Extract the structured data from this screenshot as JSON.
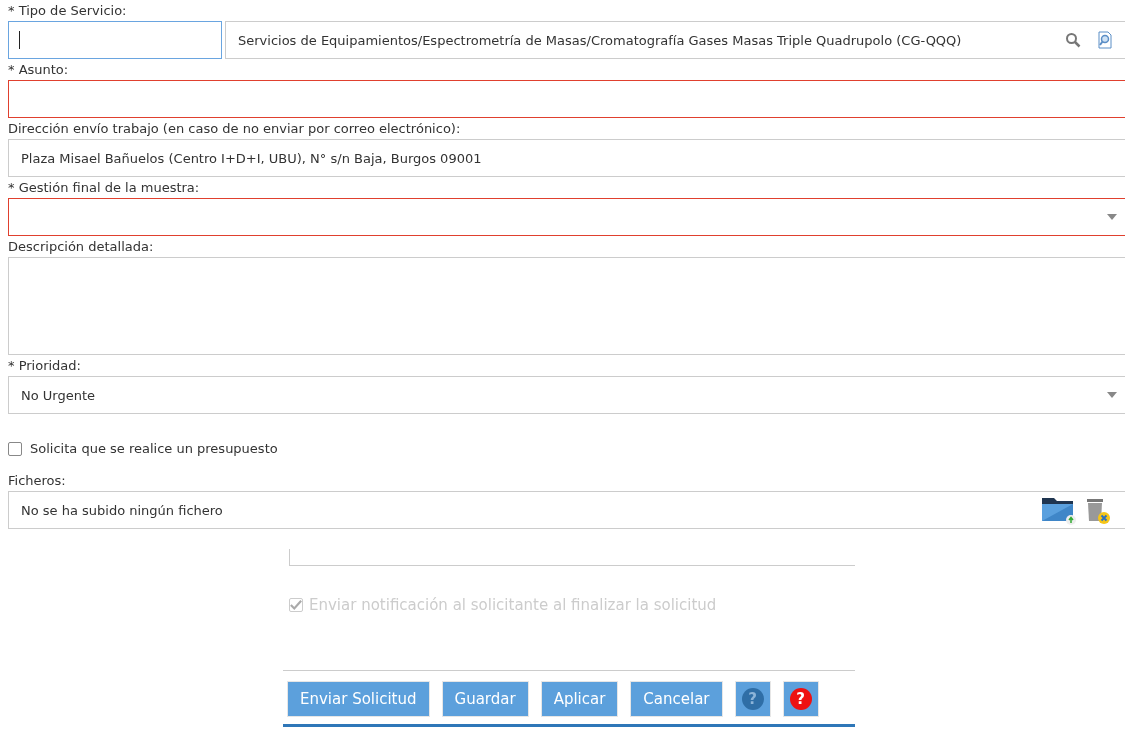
{
  "form": {
    "fields": [
      {
        "kind": "lookup",
        "label": "* Tipo de Servicio:",
        "focused": true,
        "value": "Servicios de Equipamientos/Espectrometría de Masas/Cromatografía Gases Masas Triple Quadrupolo (CG-QQQ)"
      },
      {
        "kind": "text",
        "label": "* Asunto:",
        "invalid": true
      },
      {
        "kind": "text",
        "label": "Dirección envío trabajo (en caso de no enviar por correo electrónico):",
        "invalid": false,
        "value": "Plaza Misael Bañuelos (Centro I+D+I, UBU), N° s/n Baja, Burgos 09001"
      },
      {
        "kind": "select",
        "label": "* Gestión final de la muestra:",
        "invalid": true
      },
      {
        "kind": "textarea",
        "label": "Descripción detallada:",
        "invalid": false
      },
      {
        "kind": "select",
        "label": "* Prioridad:",
        "invalid": false,
        "value": "No Urgente"
      },
      {
        "kind": "checkbox",
        "label": "Solicita que se realice un presupuesto",
        "checked": false,
        "disabled": false
      },
      {
        "kind": "files",
        "label": "Ficheros:",
        "invalid": false,
        "value": "No se ha subido ningún fichero"
      }
    ]
  },
  "dialog": {
    "notify": {
      "label": "Enviar notificación al solicitante al finalizar la solicitud",
      "checked": true,
      "disabled": true
    },
    "buttons": [
      {
        "kind": "text",
        "label": "Enviar Solicitud"
      },
      {
        "kind": "text",
        "label": "Guardar"
      },
      {
        "kind": "text",
        "label": "Aplicar"
      },
      {
        "kind": "text",
        "label": "Cancelar"
      },
      {
        "kind": "help",
        "label": "?"
      },
      {
        "kind": "alert-help",
        "label": "?"
      }
    ]
  }
}
